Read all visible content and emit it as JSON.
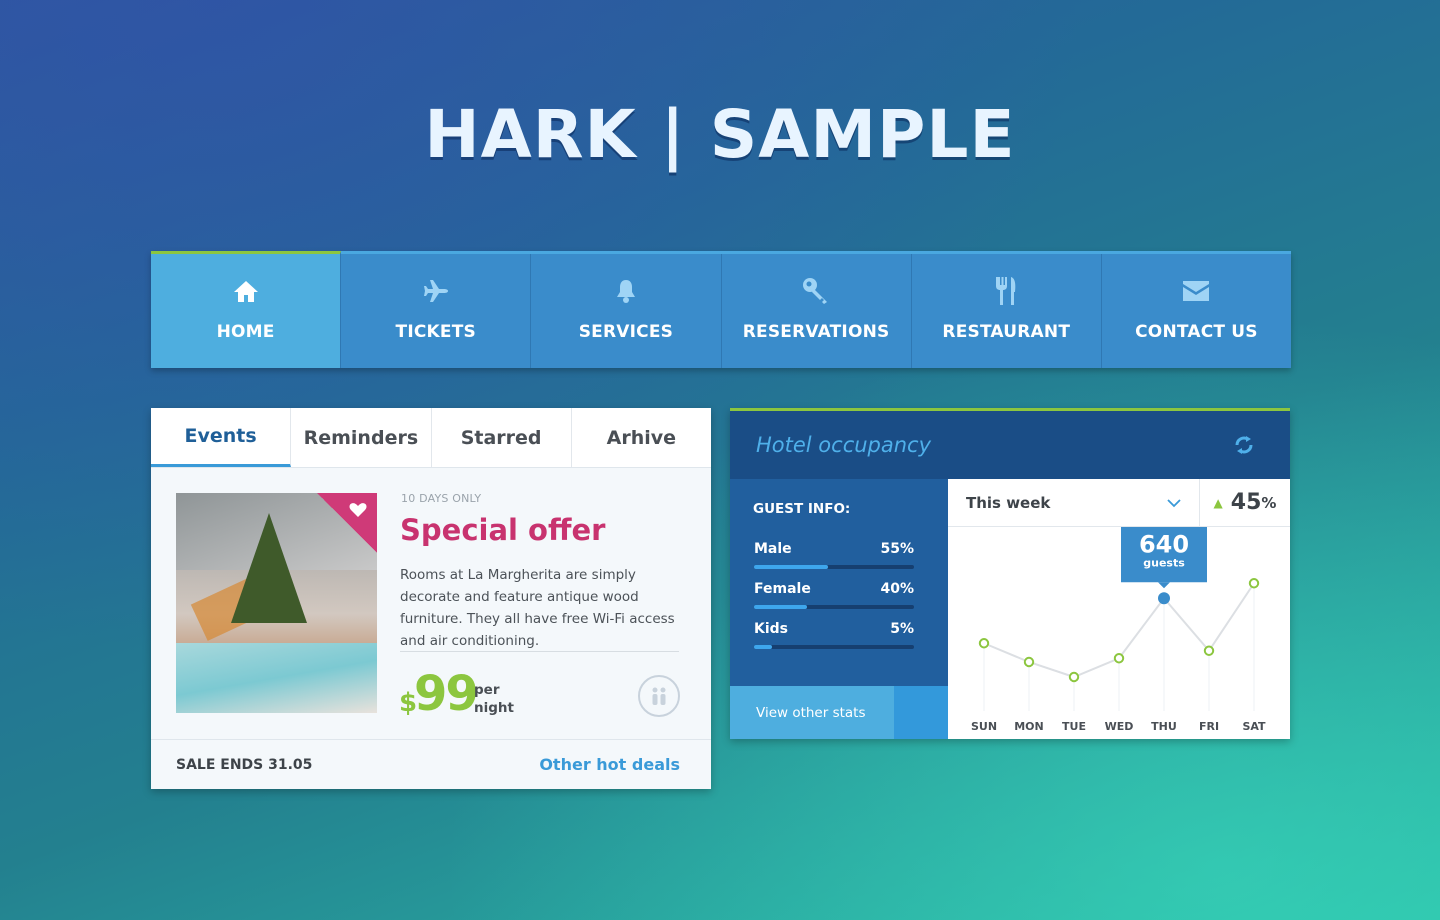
{
  "header": {
    "title": "HARK | SAMPLE"
  },
  "nav": {
    "items": [
      {
        "label": "HOME",
        "icon": "home-icon",
        "active": true
      },
      {
        "label": "TICKETS",
        "icon": "plane-icon",
        "active": false
      },
      {
        "label": "SERVICES",
        "icon": "bell-icon",
        "active": false
      },
      {
        "label": "RESERVATIONS",
        "icon": "key-icon",
        "active": false
      },
      {
        "label": "RESTAURANT",
        "icon": "fork-knife-icon",
        "active": false
      },
      {
        "label": "CONTACT US",
        "icon": "envelope-icon",
        "active": false
      }
    ]
  },
  "events": {
    "tabs": [
      "Events",
      "Reminders",
      "Starred",
      "Arhive"
    ],
    "active_tab": "Events",
    "offer": {
      "badge": "10 DAYS ONLY",
      "title": "Special offer",
      "description": "Rooms at La Margherita are simply decorate and feature antique wood furniture. They all have free Wi-Fi access and air conditioning.",
      "currency": "$",
      "price": "99",
      "per_line1": "per",
      "per_line2": "night"
    },
    "footer": {
      "sale": "SALE ENDS 31.05",
      "link": "Other hot deals"
    }
  },
  "occupancy": {
    "title": "Hotel occupancy",
    "guest_info": {
      "title": "GUEST INFO:",
      "rows": [
        {
          "label": "Male",
          "value": "55%",
          "fraction": 0.46
        },
        {
          "label": "Female",
          "value": "40%",
          "fraction": 0.33
        },
        {
          "label": "Kids",
          "value": "5%",
          "fraction": 0.11
        }
      ],
      "button": "View other stats"
    },
    "period": "This week",
    "change": {
      "value": "45",
      "unit": "%"
    },
    "tooltip": {
      "value": "640",
      "label": "guests"
    },
    "colors": {
      "accent_green": "#8cc63f",
      "point_blue": "#3a8ccb",
      "navy": "#1a4d86"
    }
  },
  "chart_data": {
    "type": "line",
    "categories": [
      "SUN",
      "MON",
      "TUE",
      "WED",
      "THU",
      "FRI",
      "SAT"
    ],
    "values": [
      520,
      470,
      430,
      480,
      640,
      500,
      680
    ],
    "highlight_index": 4,
    "ylim": [
      350,
      750
    ],
    "grid": false
  }
}
